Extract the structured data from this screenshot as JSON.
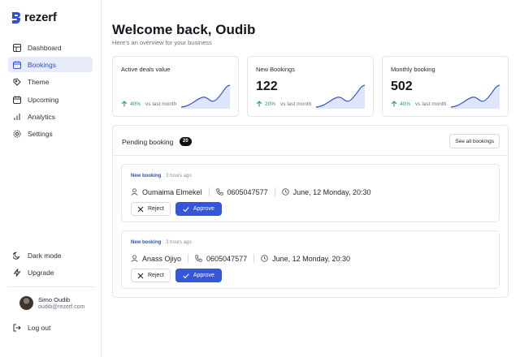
{
  "app": {
    "name": "rezerf"
  },
  "sidebar": {
    "items": [
      {
        "label": "Dashboard",
        "icon": "grid-icon",
        "active": false
      },
      {
        "label": "Bookings",
        "icon": "calendar-icon",
        "active": true
      },
      {
        "label": "Theme",
        "icon": "palette-icon",
        "active": false
      },
      {
        "label": "Upcoming",
        "icon": "calendar-clock-icon",
        "active": false
      },
      {
        "label": "Analytics",
        "icon": "bar-chart-icon",
        "active": false
      },
      {
        "label": "Settings",
        "icon": "gear-icon",
        "active": false
      }
    ],
    "bottom": [
      {
        "label": "Dark mode",
        "icon": "moon-icon"
      },
      {
        "label": "Upgrade",
        "icon": "bolt-icon"
      }
    ],
    "user": {
      "name": "Simo Oudib",
      "email": "oudib@rezerf.com"
    },
    "logout": "Log out"
  },
  "header": {
    "title": "Welcome back, Oudib",
    "subtitle": "Here's an overview for your business"
  },
  "stats": [
    {
      "label": "Active deals value",
      "value": "",
      "change": "40%",
      "compare": "vs last month"
    },
    {
      "label": "New Bookings",
      "value": "122",
      "change": "20%",
      "compare": "vs last month"
    },
    {
      "label": "Monthly booking",
      "value": "502",
      "change": "40%",
      "compare": "vs last month"
    }
  ],
  "pending": {
    "title": "Pending booking",
    "count": "20",
    "see_all": "See all bookings",
    "bookings": [
      {
        "tag": "New booking",
        "time": "3 hours ago",
        "name": "Oumaima Elmekel",
        "phone": "0605047577",
        "date": "June, 12 Monday, 20:30",
        "reject": "Reject",
        "approve": "Approve"
      },
      {
        "tag": "New booking",
        "time": "3 hours ago",
        "name": "Anass Ojiyo",
        "phone": "0605047577",
        "date": "June, 12 Monday, 20:30",
        "reject": "Reject",
        "approve": "Approve"
      }
    ]
  },
  "colors": {
    "accent": "#3556d8",
    "active_bg": "#e8ecfa",
    "positive": "#1f9d55",
    "badge": "#111111"
  }
}
